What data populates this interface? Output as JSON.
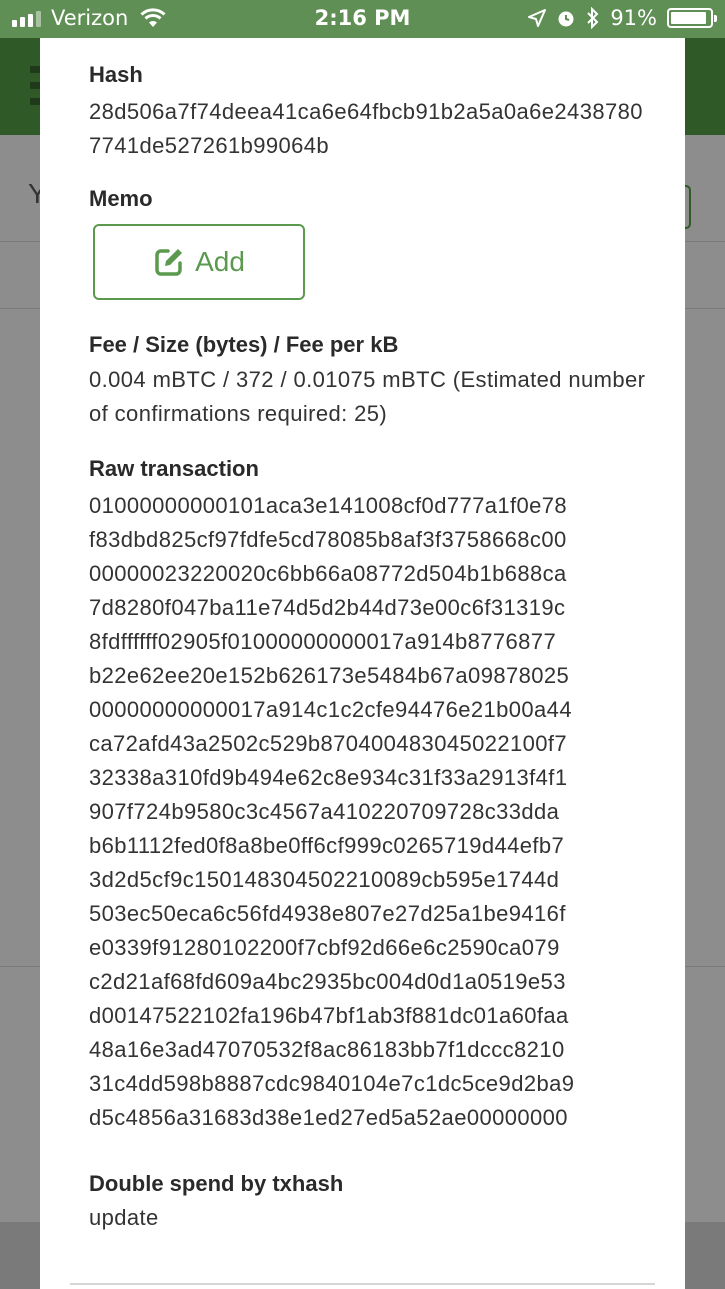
{
  "status_bar": {
    "carrier": "Verizon",
    "time": "2:16 PM",
    "battery_text": "91%",
    "battery_level": 0.91
  },
  "transaction_detail": {
    "hash": {
      "label": "Hash",
      "value": "28d506a7f74deea41ca6e64fbcb91b2a5a0a6e24387807741de527261b99064b"
    },
    "memo": {
      "label": "Memo",
      "add_label": "Add",
      "icon": "edit-icon"
    },
    "fee": {
      "label": "Fee / Size (bytes) / Fee per kB",
      "value": "0.004 mBTC / 372 / 0.01075 mBTC (Estimated number of confirmations required: 25)"
    },
    "raw_transaction": {
      "label": "Raw transaction",
      "lines": [
        "01000000000101aca3e141008cf0d777a1f0e78",
        "f83dbd825cf97fdfe5cd78085b8af3f3758668c00",
        "00000023220020c6bb66a08772d504b1b688ca",
        "7d8280f047ba11e74d5d2b44d73e00c6f31319c",
        "8fdffffff02905f01000000000017a914b8776877",
        "b22e62ee20e152b626173e5484b67a09878025",
        "00000000000017a914c1c2cfe94476e21b00a44",
        "ca72afd43a2502c529b870400483045022100f7",
        "32338a310fd9b494e62c8e934c31f33a2913f4f1",
        "907f724b9580c3c4567a410220709728c33dda",
        "b6b1112fed0f8a8be0ff6cf999c0265719d44efb7",
        "3d2d5cf9c150148304502210089cb595e1744d",
        "503ec50eca6c56fd4938e807e27d25a1be9416f",
        "e0339f91280102200f7cbf92d66e6c2590ca079",
        "c2d21af68fd609a4bc2935bc004d0d1a0519e53",
        "d00147522102fa196b47bf1ab3f881dc01a60faa",
        "48a16e3ad47070532f8ac86183bb7f1dccc8210",
        "31c4dd598b8887cdc9840104e7c1dc5ce9d2ba9",
        "d5c4856a31683d38e1ed27ed5a52ae00000000"
      ]
    },
    "double_spend": {
      "label": "Double spend by txhash",
      "value": "update"
    }
  },
  "colors": {
    "accent": "#5b9a4e",
    "header_bg": "#2f5a27",
    "status_bar_bg": "#5f8f55"
  }
}
